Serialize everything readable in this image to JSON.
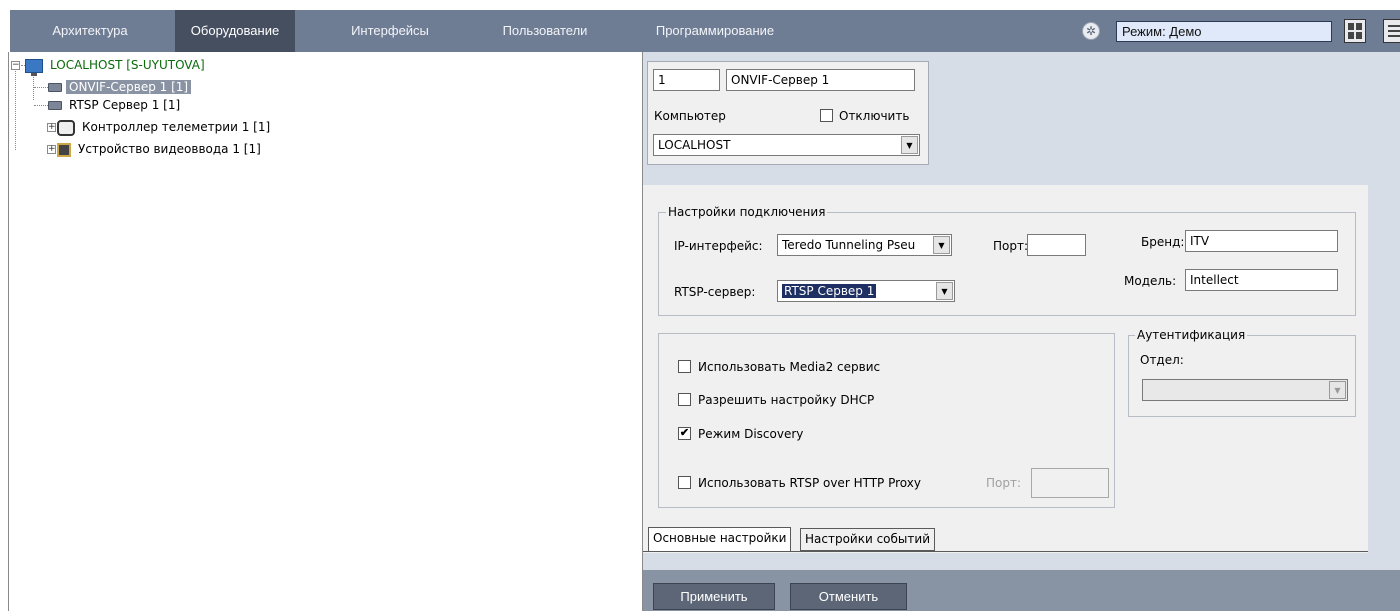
{
  "top_tabs": [
    "Архитектура",
    "Оборудование",
    "Интерфейсы",
    "Пользователи",
    "Программирование"
  ],
  "active_tab": "Оборудование",
  "mode_label": "Режим: Демо",
  "tree": {
    "root": "LOCALHOST [S-UYUTOVA]",
    "items": [
      {
        "label": "ONVIF-Сервер 1 [1]",
        "icon": "server-icon",
        "selected": true
      },
      {
        "label": "RTSP Сервер 1 [1]",
        "icon": "server-icon",
        "selected": false
      },
      {
        "label": "Контроллер телеметрии 1 [1]",
        "icon": "ptz-icon",
        "selected": false
      },
      {
        "label": "Устройство видеоввода 1 [1]",
        "icon": "chip-icon",
        "selected": false
      }
    ]
  },
  "object": {
    "id": "1",
    "name": "ONVIF-Сервер 1",
    "computer_label": "Компьютер",
    "disable_label": "Отключить",
    "computer_value": "LOCALHOST"
  },
  "connection": {
    "group_title": "Настройки подключения",
    "ip_label": "IP-интерфейс:",
    "ip_value": "Teredo Tunneling Pseu",
    "port_label": "Порт:",
    "port_value": "",
    "brand_label": "Бренд:",
    "brand_value": "ITV",
    "rtsp_label": "RTSP-сервер:",
    "rtsp_value": "RTSP Сервер 1",
    "model_label": "Модель:",
    "model_value": "Intellect"
  },
  "options": {
    "media2": {
      "label": "Использовать Media2 сервис",
      "checked": false
    },
    "dhcp": {
      "label": "Разрешить настройку DHCP",
      "checked": false
    },
    "discovery": {
      "label": "Режим Discovery",
      "checked": true
    },
    "rtsp_proxy": {
      "label": "Использовать RTSP over HTTP Proxy",
      "checked": false
    },
    "proxy_port_label": "Порт:",
    "check_mark": "✔"
  },
  "auth": {
    "group_title": "Аутентификация",
    "dept_label": "Отдел:",
    "dept_value": ""
  },
  "sub_tabs": [
    "Основные настройки",
    "Настройки событий"
  ],
  "buttons": {
    "apply": "Применить",
    "cancel": "Отменить"
  }
}
